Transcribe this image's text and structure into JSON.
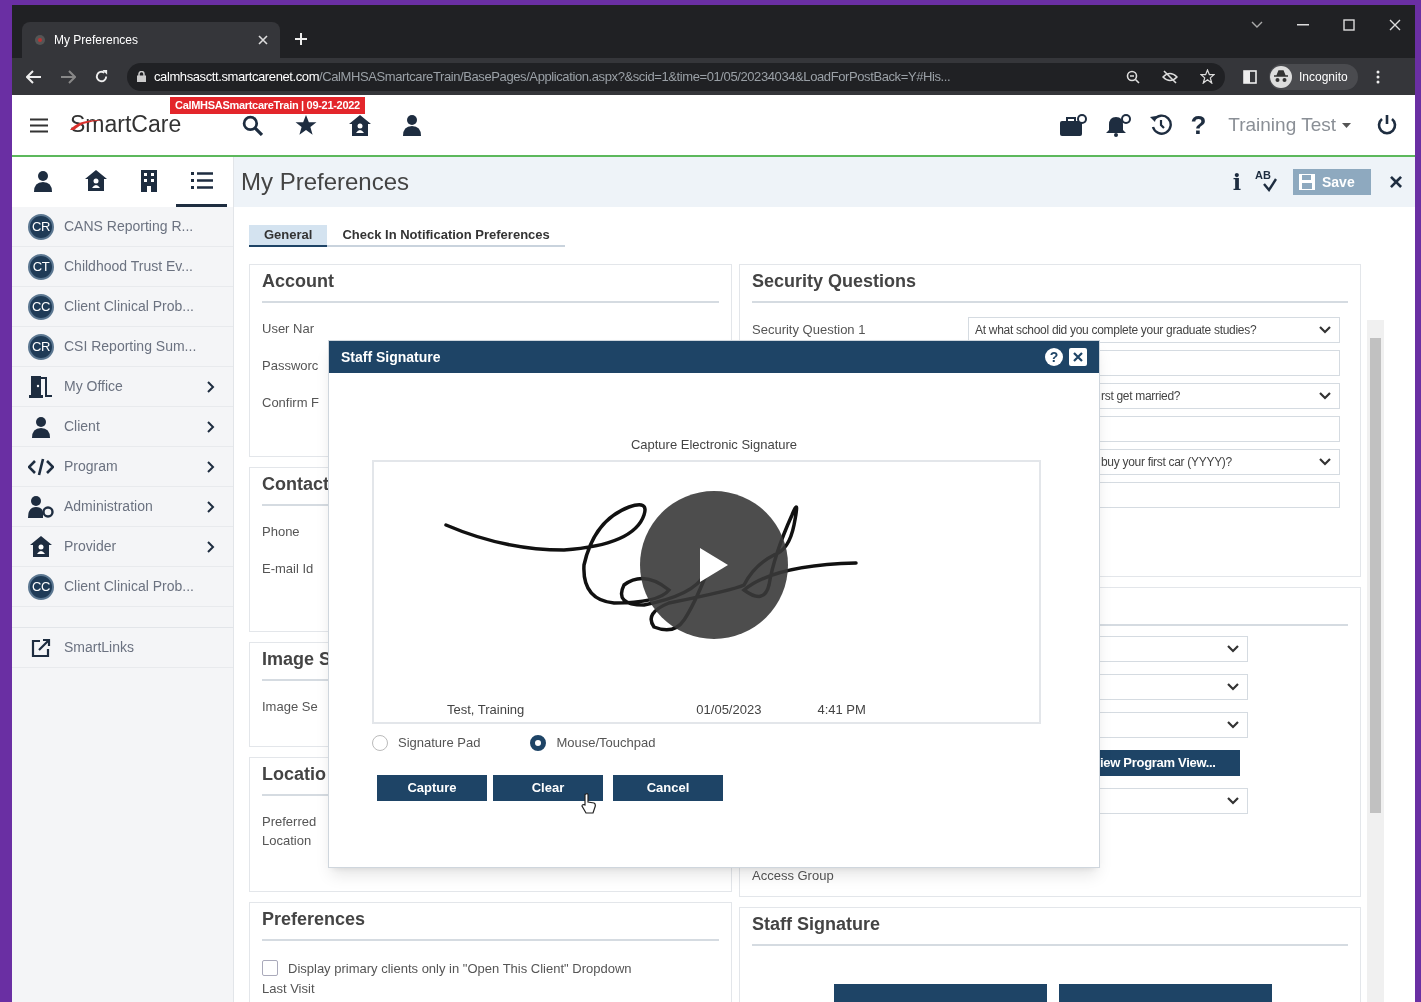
{
  "browser": {
    "tab_title": "My Preferences",
    "url_host": "calmhsasctt.smartcarenet.com",
    "url_path": "/CalMHSASmartcareTrain/BasePages/Application.aspx?&scid=1&time=01/05/20234034&LoadForPostBack=Y#His...",
    "profile_label": "Incognito"
  },
  "app_header": {
    "logo": "SmartCare",
    "environment_badge": "CalMHSASmartcareTrain | 09-21-2022",
    "help_glyph": "?",
    "user_menu": "Training Test"
  },
  "nav": {
    "tabs": [
      {
        "kind": "person",
        "selected": false
      },
      {
        "kind": "home",
        "selected": false
      },
      {
        "kind": "building",
        "selected": false
      },
      {
        "kind": "list",
        "selected": true
      }
    ],
    "items": [
      {
        "kind": "initials",
        "initials": "CR",
        "label": "CANS Reporting R...",
        "has_submenu": false
      },
      {
        "kind": "initials",
        "initials": "CT",
        "label": "Childhood Trust Ev...",
        "has_submenu": false
      },
      {
        "kind": "initials",
        "initials": "CC",
        "label": "Client Clinical Prob...",
        "has_submenu": false
      },
      {
        "kind": "initials",
        "initials": "CR",
        "label": "CSI Reporting Sum...",
        "has_submenu": false
      },
      {
        "kind": "office",
        "label": "My Office",
        "has_submenu": true
      },
      {
        "kind": "person",
        "label": "Client",
        "has_submenu": true
      },
      {
        "kind": "code",
        "label": "Program",
        "has_submenu": true
      },
      {
        "kind": "admin",
        "label": "Administration",
        "has_submenu": true
      },
      {
        "kind": "provider",
        "label": "Provider",
        "has_submenu": true
      },
      {
        "kind": "initials",
        "initials": "CC",
        "label": "Client Clinical Prob...",
        "has_submenu": false
      }
    ],
    "links": [
      {
        "kind": "link",
        "label": "SmartLinks"
      }
    ]
  },
  "page": {
    "title": "My Preferences",
    "info_glyph": "i",
    "spellcheck_label": "AB",
    "save_button": "Save",
    "close_glyph": "×",
    "tabs": [
      {
        "label": "General",
        "selected": true
      },
      {
        "label": "Check In Notification Preferences",
        "selected": false
      }
    ]
  },
  "left_panels": [
    {
      "title": "Account",
      "rows": [
        {
          "kind": "label",
          "label": "User Nar"
        },
        {
          "kind": "label",
          "label": "Passworc"
        },
        {
          "kind": "label",
          "label": "Confirm F"
        }
      ]
    },
    {
      "title": "Contact",
      "rows": [
        {
          "kind": "label",
          "label": "Phone"
        },
        {
          "kind": "label",
          "label": "E-mail Id"
        }
      ]
    },
    {
      "title": "Image S",
      "rows": [
        {
          "kind": "label",
          "label": "Image Se"
        }
      ]
    },
    {
      "title": "Locatio",
      "rows": [
        {
          "kind": "label",
          "label": "Preferred Location"
        }
      ]
    },
    {
      "title": "Preferences",
      "rows": [
        {
          "kind": "checkbox",
          "label": "Display primary clients only in \"Open This Client\" Dropdown",
          "checked": false
        },
        {
          "kind": "label",
          "label": "Last Visit"
        }
      ]
    }
  ],
  "right_panels": [
    {
      "title": "Security Questions",
      "rows": [
        {
          "kind": "select",
          "label": "Security Question 1",
          "value": "At what school did you complete your graduate studies?"
        },
        {
          "kind": "text"
        },
        {
          "kind": "select",
          "value": "rst get married?"
        },
        {
          "kind": "text"
        },
        {
          "kind": "select",
          "value": "buy your first car (YYYY)?"
        },
        {
          "kind": "text"
        }
      ]
    },
    {
      "rows": [
        {
          "kind": "select"
        },
        {
          "kind": "select"
        },
        {
          "kind": "select"
        },
        {
          "kind": "button",
          "label": "iew Program View..."
        },
        {
          "kind": "select"
        },
        {
          "kind": "label",
          "label": "Access Group"
        }
      ]
    },
    {
      "title": "Staff Signature",
      "rows": [
        {
          "kind": "buttons"
        }
      ]
    }
  ],
  "modal": {
    "title": "Staff Signature",
    "help_glyph": "?",
    "caption": "Capture Electronic Signature",
    "signer": "Test, Training",
    "date": "01/05/2023",
    "time": "4:41 PM",
    "options": [
      {
        "label": "Signature Pad",
        "selected": false
      },
      {
        "label": "Mouse/Touchpad",
        "selected": true
      }
    ],
    "buttons": [
      "Capture",
      "Clear",
      "Cancel"
    ]
  }
}
